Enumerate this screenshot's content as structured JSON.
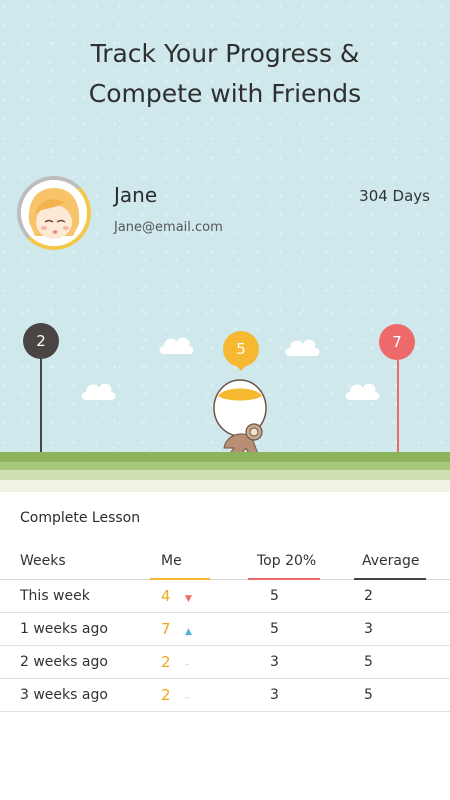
{
  "headline": {
    "line1": "Track Your Progress &",
    "line2": "Compete with Friends"
  },
  "profile": {
    "name": "Jane",
    "email": "Jane@email.com",
    "days": "304 Days"
  },
  "balloons": [
    {
      "value": "2",
      "color": "#4a4442"
    },
    {
      "value": "5",
      "color": "#f5b830"
    },
    {
      "value": "7",
      "color": "#ee6a6a"
    }
  ],
  "section_title": "Complete Lesson",
  "table": {
    "headers": {
      "weeks": "Weeks",
      "me": "Me",
      "top": "Top 20%",
      "avg": "Average"
    },
    "underline_colors": {
      "me": "#f5b830",
      "top": "#ee6a6a",
      "avg": "#4a4442"
    },
    "rows": [
      {
        "week": "This week",
        "me": "4",
        "trend": "▼",
        "trend_color": "#ee6a6a",
        "top": "5",
        "avg": "2"
      },
      {
        "week": "1 weeks ago",
        "me": "7",
        "trend": "▲",
        "trend_color": "#4fb3d8",
        "top": "5",
        "avg": "3"
      },
      {
        "week": "2 weeks ago",
        "me": "2",
        "trend": "–",
        "trend_color": "#bbbbbb",
        "top": "3",
        "avg": "5"
      },
      {
        "week": "3 weeks ago",
        "me": "2",
        "trend": "–",
        "trend_color": "#bbbbbb",
        "top": "3",
        "avg": "5"
      }
    ]
  }
}
